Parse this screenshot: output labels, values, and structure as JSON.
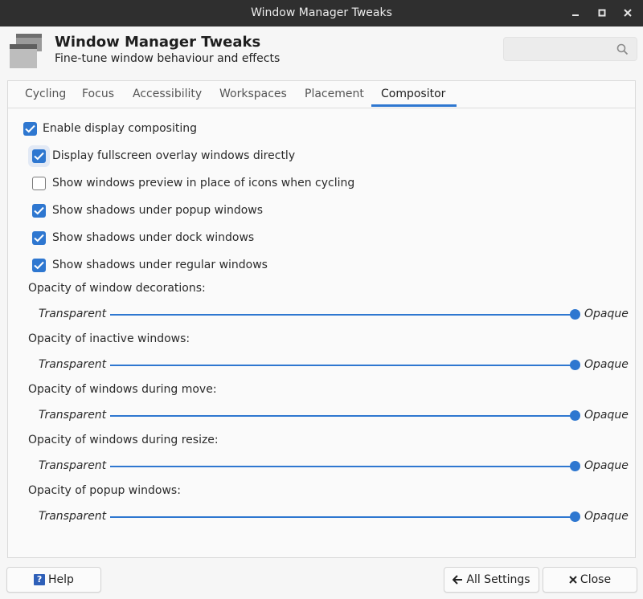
{
  "window": {
    "title": "Window Manager Tweaks",
    "controls": [
      "minimize-icon",
      "maximize-icon",
      "close-icon"
    ]
  },
  "header": {
    "title": "Window Manager Tweaks",
    "subtitle": "Fine-tune window behaviour and effects",
    "search_placeholder": "",
    "search_icon": "search-icon"
  },
  "tabs": [
    {
      "label": "Cycling",
      "active": false
    },
    {
      "label": "Focus",
      "active": false
    },
    {
      "label": "Accessibility",
      "active": false
    },
    {
      "label": "Workspaces",
      "active": false
    },
    {
      "label": "Placement",
      "active": false
    },
    {
      "label": "Compositor",
      "active": true
    }
  ],
  "compositor": {
    "enable": {
      "label": "Enable display compositing",
      "checked": true
    },
    "options": [
      {
        "label": "Display fullscreen overlay windows directly",
        "checked": true
      },
      {
        "label": "Show windows preview in place of icons when cycling",
        "checked": false
      },
      {
        "label": "Show shadows under popup windows",
        "checked": true
      },
      {
        "label": "Show shadows under dock windows",
        "checked": true
      },
      {
        "label": "Show shadows under regular windows",
        "checked": true
      }
    ],
    "sliders": [
      {
        "label": "Opacity of window decorations:",
        "min_label": "Transparent",
        "max_label": "Opaque",
        "value": 1.0
      },
      {
        "label": "Opacity of inactive windows:",
        "min_label": "Transparent",
        "max_label": "Opaque",
        "value": 1.0
      },
      {
        "label": "Opacity of windows during move:",
        "min_label": "Transparent",
        "max_label": "Opaque",
        "value": 1.0
      },
      {
        "label": "Opacity of windows during resize:",
        "min_label": "Transparent",
        "max_label": "Opaque",
        "value": 1.0
      },
      {
        "label": "Opacity of popup windows:",
        "min_label": "Transparent",
        "max_label": "Opaque",
        "value": 1.0
      }
    ]
  },
  "footer": {
    "help_label": "Help",
    "all_settings_label": "All Settings",
    "close_label": "Close"
  },
  "colors": {
    "accent": "#2e77d0",
    "titlebar": "#2f2f2f"
  }
}
